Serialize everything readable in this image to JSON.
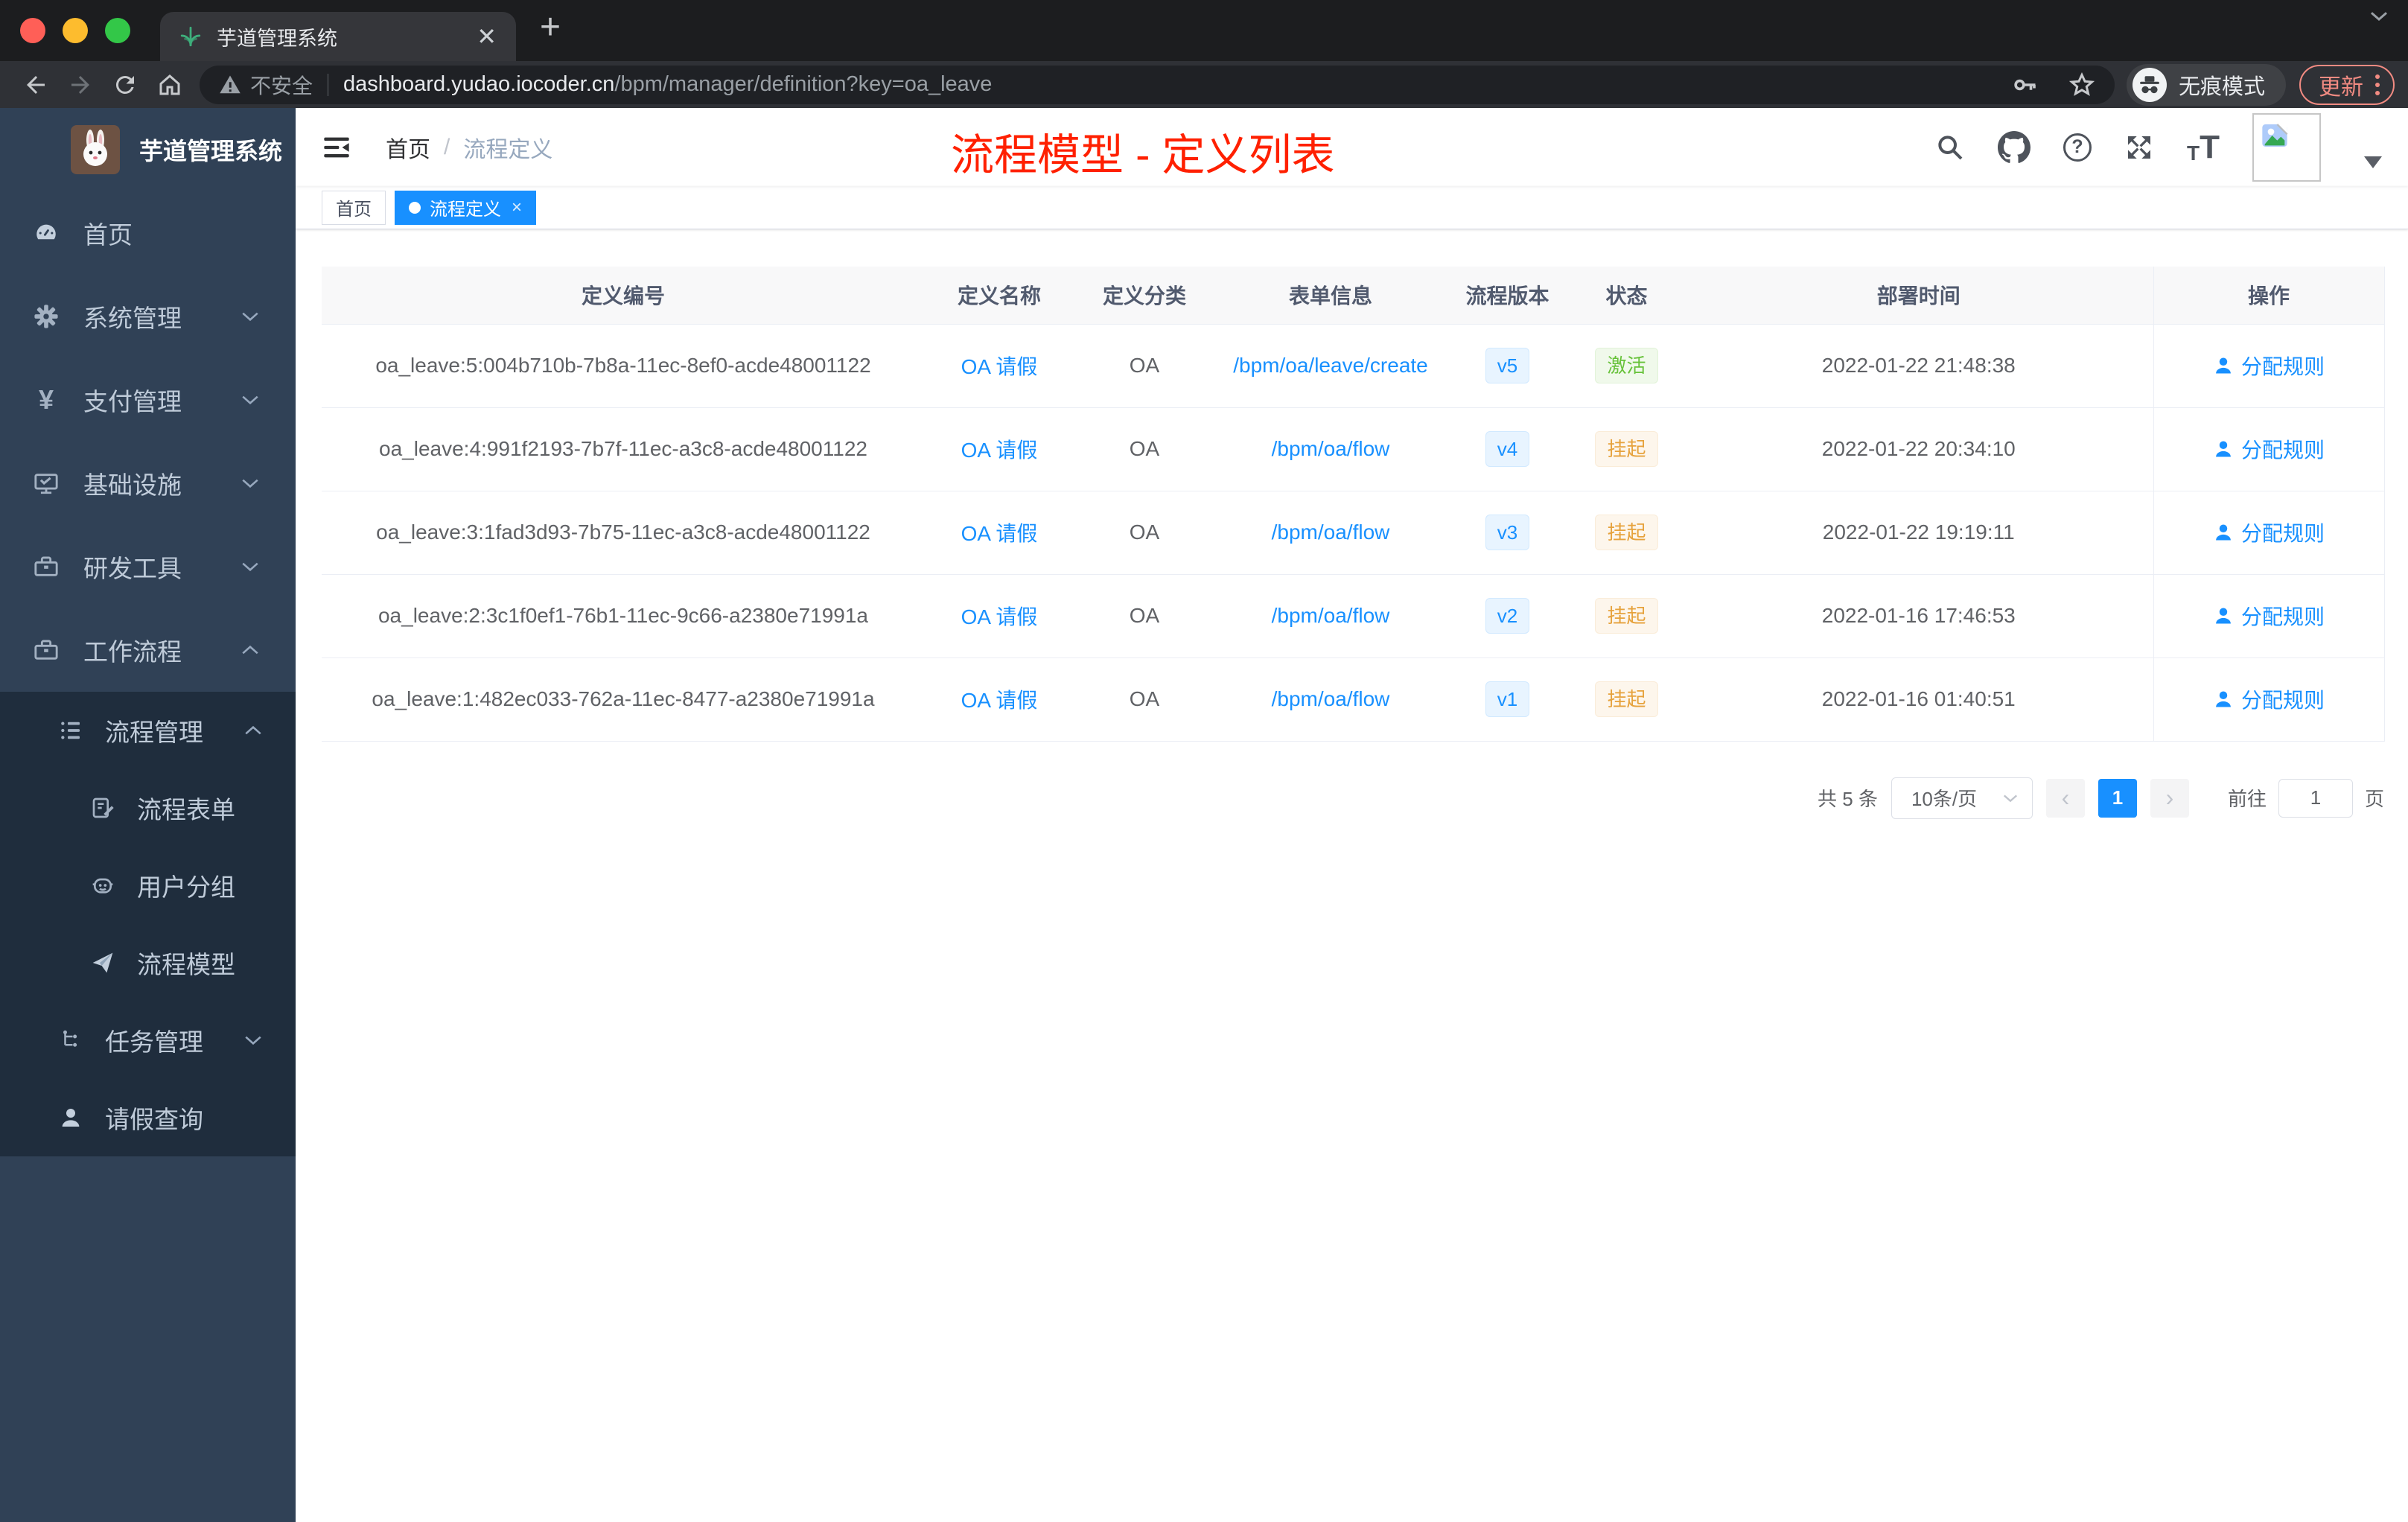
{
  "browser": {
    "tab_title": "芋道管理系统",
    "security_label": "不安全",
    "url_domain": "dashboard.yudao.iocoder.cn",
    "url_path": "/bpm/manager/definition?key=oa_leave",
    "incognito_label": "无痕模式",
    "update_label": "更新"
  },
  "sidebar": {
    "app_title": "芋道管理系统",
    "menu": [
      {
        "label": "首页"
      },
      {
        "label": "系统管理"
      },
      {
        "label": "支付管理"
      },
      {
        "label": "基础设施"
      },
      {
        "label": "研发工具"
      },
      {
        "label": "工作流程"
      }
    ],
    "submenu": {
      "process_mgmt": "流程管理",
      "process_form": "流程表单",
      "user_group": "用户分组",
      "process_model": "流程模型",
      "task_mgmt": "任务管理",
      "leave_query": "请假查询"
    }
  },
  "header": {
    "breadcrumb_home": "首页",
    "breadcrumb_sep": "/",
    "breadcrumb_current": "流程定义",
    "annotation_title": "流程模型 - 定义列表"
  },
  "tags": {
    "home": "首页",
    "current": "流程定义"
  },
  "table": {
    "columns": [
      "定义编号",
      "定义名称",
      "定义分类",
      "表单信息",
      "流程版本",
      "状态",
      "部署时间",
      "操作"
    ],
    "rows": [
      {
        "id": "oa_leave:5:004b710b-7b8a-11ec-8ef0-acde48001122",
        "name": "OA 请假",
        "category": "OA",
        "form": "/bpm/oa/leave/create",
        "version": "v5",
        "status": "激活",
        "status_type": "success",
        "deploy_time": "2022-01-22 21:48:38",
        "action": "分配规则"
      },
      {
        "id": "oa_leave:4:991f2193-7b7f-11ec-a3c8-acde48001122",
        "name": "OA 请假",
        "category": "OA",
        "form": "/bpm/oa/flow",
        "version": "v4",
        "status": "挂起",
        "status_type": "warning",
        "deploy_time": "2022-01-22 20:34:10",
        "action": "分配规则"
      },
      {
        "id": "oa_leave:3:1fad3d93-7b75-11ec-a3c8-acde48001122",
        "name": "OA 请假",
        "category": "OA",
        "form": "/bpm/oa/flow",
        "version": "v3",
        "status": "挂起",
        "status_type": "warning",
        "deploy_time": "2022-01-22 19:19:11",
        "action": "分配规则"
      },
      {
        "id": "oa_leave:2:3c1f0ef1-76b1-11ec-9c66-a2380e71991a",
        "name": "OA 请假",
        "category": "OA",
        "form": "/bpm/oa/flow",
        "version": "v2",
        "status": "挂起",
        "status_type": "warning",
        "deploy_time": "2022-01-16 17:46:53",
        "action": "分配规则"
      },
      {
        "id": "oa_leave:1:482ec033-762a-11ec-8477-a2380e71991a",
        "name": "OA 请假",
        "category": "OA",
        "form": "/bpm/oa/flow",
        "version": "v1",
        "status": "挂起",
        "status_type": "warning",
        "deploy_time": "2022-01-16 01:40:51",
        "action": "分配规则"
      }
    ]
  },
  "pagination": {
    "total": "共 5 条",
    "page_size": "10条/页",
    "prev": "‹",
    "current": "1",
    "next": "›",
    "goto": "前往",
    "unit": "页"
  },
  "colors": {
    "primary": "#1890ff",
    "success": "#67c23a",
    "warning": "#e6a23c",
    "sidebar_bg": "#304156",
    "submenu_bg": "#1f2d3d",
    "annotation_red": "#ff2000"
  }
}
